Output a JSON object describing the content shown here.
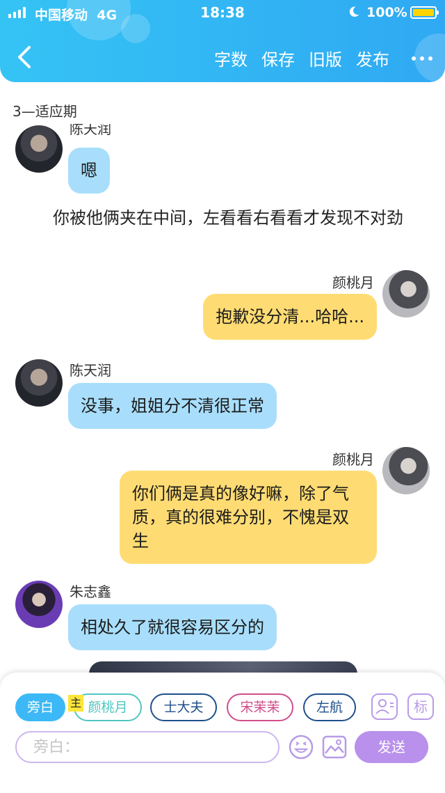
{
  "status_bar": {
    "carrier": "中国移动",
    "network": "4G",
    "time": "18:38",
    "battery": "100%"
  },
  "header": {
    "actions": [
      "字数",
      "保存",
      "旧版",
      "发布"
    ]
  },
  "chapter_title": "3—适应期",
  "messages": [
    {
      "speaker": "陈天润",
      "text": "嗯",
      "side": "left",
      "avatar": "chen-tianrun"
    },
    {
      "narration": "你被他俩夹在中间，左看看右看看才发现不对劲"
    },
    {
      "speaker": "颜桃月",
      "text": "抱歉没分清...哈哈...",
      "side": "right",
      "avatar": "yan-taoyue"
    },
    {
      "speaker": "陈天润",
      "text": "没事，姐姐分不清很正常",
      "side": "left",
      "avatar": "chen-tianrun"
    },
    {
      "speaker": "颜桃月",
      "text": "你们俩是真的像好嘛，除了气质，真的很难分别，不愧是双生",
      "side": "right",
      "avatar": "yan-taoyue"
    },
    {
      "speaker": "朱志鑫",
      "text": "相处久了就很容易区分的",
      "side": "left",
      "avatar": "zhu-zhixin"
    }
  ],
  "roles": [
    {
      "label": "旁白",
      "active": true,
      "color": "#3cb8f6"
    },
    {
      "label": "颜桃月",
      "active": false,
      "color": "#4fc6c0"
    },
    {
      "label": "士大夫",
      "active": false,
      "color": "#1f4f8a"
    },
    {
      "label": "宋茉茉",
      "active": false,
      "color": "#d04d8a"
    },
    {
      "label": "左航",
      "active": false,
      "color": "#1f4f8a"
    }
  ],
  "main_badge": "主",
  "tools": {
    "mark": "标"
  },
  "composer": {
    "placeholder": "旁白：",
    "send_label": "发送"
  },
  "colors": {
    "header_gradient_start": "#35c3f4",
    "header_gradient_end": "#2fa9f3",
    "left_bubble": "#a8defb",
    "right_bubble": "#ffdc73",
    "send_button": "#b991ec",
    "accent_purple": "#b89be8"
  },
  "icons": [
    "back-chevron-icon",
    "more-dots-icon",
    "person-card-icon",
    "emoji-icon",
    "image-icon",
    "moon-icon",
    "signal-icon",
    "battery-icon"
  ]
}
